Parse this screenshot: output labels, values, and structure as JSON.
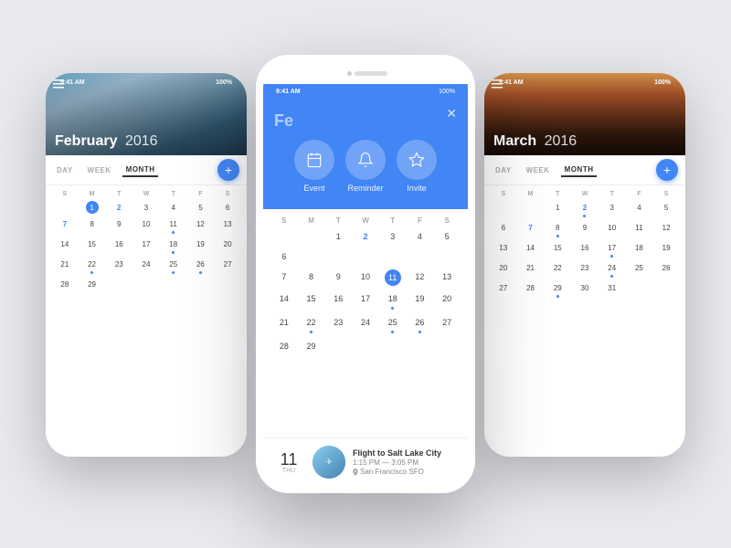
{
  "scene": {
    "bg_color": "#e8eaf0"
  },
  "left_phone": {
    "status": {
      "time": "9:41 AM",
      "battery": "100%"
    },
    "hero": {
      "month": "February",
      "year": "2016",
      "bg_class": "hero-left"
    },
    "tabs": [
      "DAY",
      "WEEK",
      "MONTH"
    ],
    "active_tab": "MONTH",
    "calendar": {
      "headers": [
        "S",
        "M",
        "T",
        "W",
        "T",
        "F",
        "S"
      ],
      "weeks": [
        [
          {
            "n": "",
            "cls": ""
          },
          {
            "n": "1",
            "cls": "today"
          },
          {
            "n": "2",
            "cls": "highlight"
          },
          {
            "n": "3",
            "cls": ""
          },
          {
            "n": "4",
            "cls": ""
          },
          {
            "n": "5",
            "cls": ""
          },
          {
            "n": "6",
            "cls": ""
          }
        ],
        [
          {
            "n": "7",
            "cls": "highlight"
          },
          {
            "n": "8",
            "cls": ""
          },
          {
            "n": "9",
            "cls": ""
          },
          {
            "n": "10",
            "cls": ""
          },
          {
            "n": "11",
            "cls": "",
            "dot": true
          },
          {
            "n": "12",
            "cls": ""
          },
          {
            "n": "13",
            "cls": ""
          }
        ],
        [
          {
            "n": "14",
            "cls": ""
          },
          {
            "n": "15",
            "cls": ""
          },
          {
            "n": "16",
            "cls": ""
          },
          {
            "n": "17",
            "cls": ""
          },
          {
            "n": "18",
            "cls": "",
            "dot": true
          },
          {
            "n": "19",
            "cls": ""
          },
          {
            "n": "20",
            "cls": ""
          }
        ],
        [
          {
            "n": "21",
            "cls": ""
          },
          {
            "n": "22",
            "cls": "",
            "dot": true
          },
          {
            "n": "23",
            "cls": ""
          },
          {
            "n": "24",
            "cls": ""
          },
          {
            "n": "25",
            "cls": "",
            "dot": true
          },
          {
            "n": "26",
            "cls": "",
            "dot": true
          },
          {
            "n": "27",
            "cls": ""
          }
        ],
        [
          {
            "n": "28",
            "cls": ""
          },
          {
            "n": "29",
            "cls": ""
          },
          {
            "n": "",
            "cls": ""
          },
          {
            "n": "",
            "cls": ""
          },
          {
            "n": "",
            "cls": ""
          },
          {
            "n": "",
            "cls": ""
          },
          {
            "n": "",
            "cls": ""
          }
        ]
      ]
    }
  },
  "right_phone": {
    "status": {
      "time": "9:41 AM",
      "battery": "100%"
    },
    "hero": {
      "month": "March",
      "year": "2016",
      "bg_class": "hero-right"
    },
    "tabs": [
      "DAY",
      "WEEK",
      "MONTH"
    ],
    "active_tab": "MONTH",
    "calendar": {
      "headers": [
        "S",
        "M",
        "T",
        "W",
        "T",
        "F",
        "S"
      ],
      "weeks": [
        [
          {
            "n": "",
            "cls": ""
          },
          {
            "n": "",
            "cls": ""
          },
          {
            "n": "1",
            "cls": ""
          },
          {
            "n": "2",
            "cls": "highlight",
            "dot": true
          },
          {
            "n": "3",
            "cls": ""
          },
          {
            "n": "4",
            "cls": ""
          },
          {
            "n": "5",
            "cls": ""
          }
        ],
        [
          {
            "n": "6",
            "cls": ""
          },
          {
            "n": "7",
            "cls": "highlight"
          },
          {
            "n": "8",
            "cls": "",
            "dot": true
          },
          {
            "n": "9",
            "cls": ""
          },
          {
            "n": "10",
            "cls": ""
          },
          {
            "n": "11",
            "cls": ""
          },
          {
            "n": "12",
            "cls": ""
          }
        ],
        [
          {
            "n": "13",
            "cls": ""
          },
          {
            "n": "14",
            "cls": ""
          },
          {
            "n": "15",
            "cls": ""
          },
          {
            "n": "16",
            "cls": ""
          },
          {
            "n": "17",
            "cls": "",
            "dot": true
          },
          {
            "n": "18",
            "cls": ""
          },
          {
            "n": "19",
            "cls": ""
          }
        ],
        [
          {
            "n": "20",
            "cls": ""
          },
          {
            "n": "21",
            "cls": ""
          },
          {
            "n": "22",
            "cls": ""
          },
          {
            "n": "23",
            "cls": ""
          },
          {
            "n": "24",
            "cls": "",
            "dot": true
          },
          {
            "n": "25",
            "cls": ""
          },
          {
            "n": "26",
            "cls": ""
          }
        ],
        [
          {
            "n": "27",
            "cls": ""
          },
          {
            "n": "28",
            "cls": ""
          },
          {
            "n": "29",
            "cls": "",
            "dot": true
          },
          {
            "n": "30",
            "cls": ""
          },
          {
            "n": "31",
            "cls": ""
          },
          {
            "n": "",
            "cls": ""
          },
          {
            "n": "",
            "cls": ""
          }
        ]
      ]
    }
  },
  "center_phone": {
    "status": {
      "time": "9:41 AM"
    },
    "action_panel": {
      "month_hint": "Fe",
      "close_label": "×",
      "buttons": [
        {
          "icon": "📅",
          "label": "Event"
        },
        {
          "icon": "🔔",
          "label": "Reminder"
        },
        {
          "icon": "☆",
          "label": "Invite"
        }
      ]
    },
    "calendar": {
      "headers": [
        "S",
        "M",
        "T",
        "W",
        "T",
        "F",
        "S"
      ],
      "weeks": [
        [
          {
            "n": "",
            "cls": ""
          },
          {
            "n": "",
            "cls": ""
          },
          {
            "n": "1",
            "cls": ""
          },
          {
            "n": "2",
            "cls": "highlight"
          },
          {
            "n": "3",
            "cls": ""
          },
          {
            "n": "4",
            "cls": ""
          },
          {
            "n": "5",
            "cls": ""
          },
          {
            "n": "6",
            "cls": ""
          }
        ],
        [
          {
            "n": "7",
            "cls": ""
          },
          {
            "n": "8",
            "cls": ""
          },
          {
            "n": "9",
            "cls": ""
          },
          {
            "n": "10",
            "cls": ""
          },
          {
            "n": "11",
            "cls": "today"
          },
          {
            "n": "12",
            "cls": ""
          },
          {
            "n": "13",
            "cls": ""
          }
        ],
        [
          {
            "n": "14",
            "cls": ""
          },
          {
            "n": "15",
            "cls": ""
          },
          {
            "n": "16",
            "cls": ""
          },
          {
            "n": "17",
            "cls": ""
          },
          {
            "n": "18",
            "cls": "",
            "dot": true
          },
          {
            "n": "19",
            "cls": ""
          },
          {
            "n": "20",
            "cls": ""
          }
        ],
        [
          {
            "n": "21",
            "cls": ""
          },
          {
            "n": "22",
            "cls": "",
            "dot": true
          },
          {
            "n": "23",
            "cls": ""
          },
          {
            "n": "24",
            "cls": ""
          },
          {
            "n": "25",
            "cls": "",
            "dot": true
          },
          {
            "n": "26",
            "cls": "",
            "dot": true
          },
          {
            "n": "27",
            "cls": ""
          }
        ],
        [
          {
            "n": "28",
            "cls": ""
          },
          {
            "n": "29",
            "cls": ""
          },
          {
            "n": "",
            "cls": ""
          },
          {
            "n": "",
            "cls": ""
          },
          {
            "n": "",
            "cls": ""
          },
          {
            "n": "",
            "cls": ""
          },
          {
            "n": "",
            "cls": ""
          }
        ]
      ]
    },
    "event": {
      "date_num": "11",
      "date_day": "Thu",
      "title": "Flight to Salt Lake City",
      "time": "1:15 PM — 3:05 PM",
      "location": "San Francisco SFO"
    }
  },
  "labels": {
    "day": "DAY",
    "week": "WEEK",
    "month": "MONTH",
    "fab_plus": "+"
  }
}
